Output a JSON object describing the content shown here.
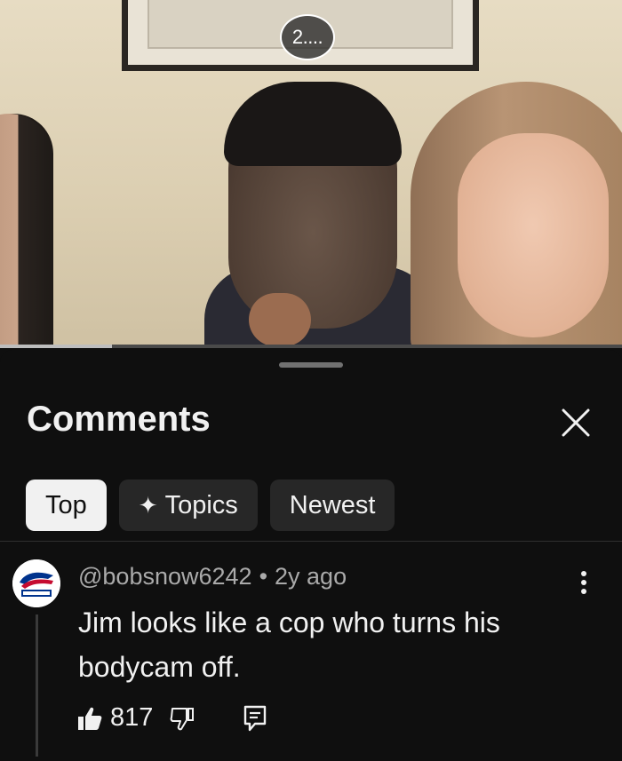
{
  "video": {
    "badge_text": "2....",
    "progress_fraction": 0.18
  },
  "comments_panel": {
    "title": "Comments",
    "close_icon": "close-icon",
    "filters": [
      {
        "label": "Top",
        "active": true
      },
      {
        "label": "Topics",
        "active": false,
        "icon": "sparkle-icon"
      },
      {
        "label": "Newest",
        "active": false
      }
    ],
    "comment": {
      "author": "@bobsnow6242",
      "separator": "•",
      "age": "2y ago",
      "text": "Jim looks like a cop who turns his bodycam off.",
      "like_count": "817",
      "icons": {
        "like": "thumbs-up-icon",
        "dislike": "thumbs-down-icon",
        "reply": "reply-icon",
        "more": "more-vertical-icon"
      }
    }
  },
  "colors": {
    "background": "#0f0f0f",
    "chip_active_bg": "#f1f1f1",
    "chip_bg": "#272727",
    "text_primary": "#f1f1f1",
    "text_secondary": "#aaaaaa",
    "avatar_brand_blue": "#00338d",
    "avatar_brand_red": "#c60c30"
  }
}
